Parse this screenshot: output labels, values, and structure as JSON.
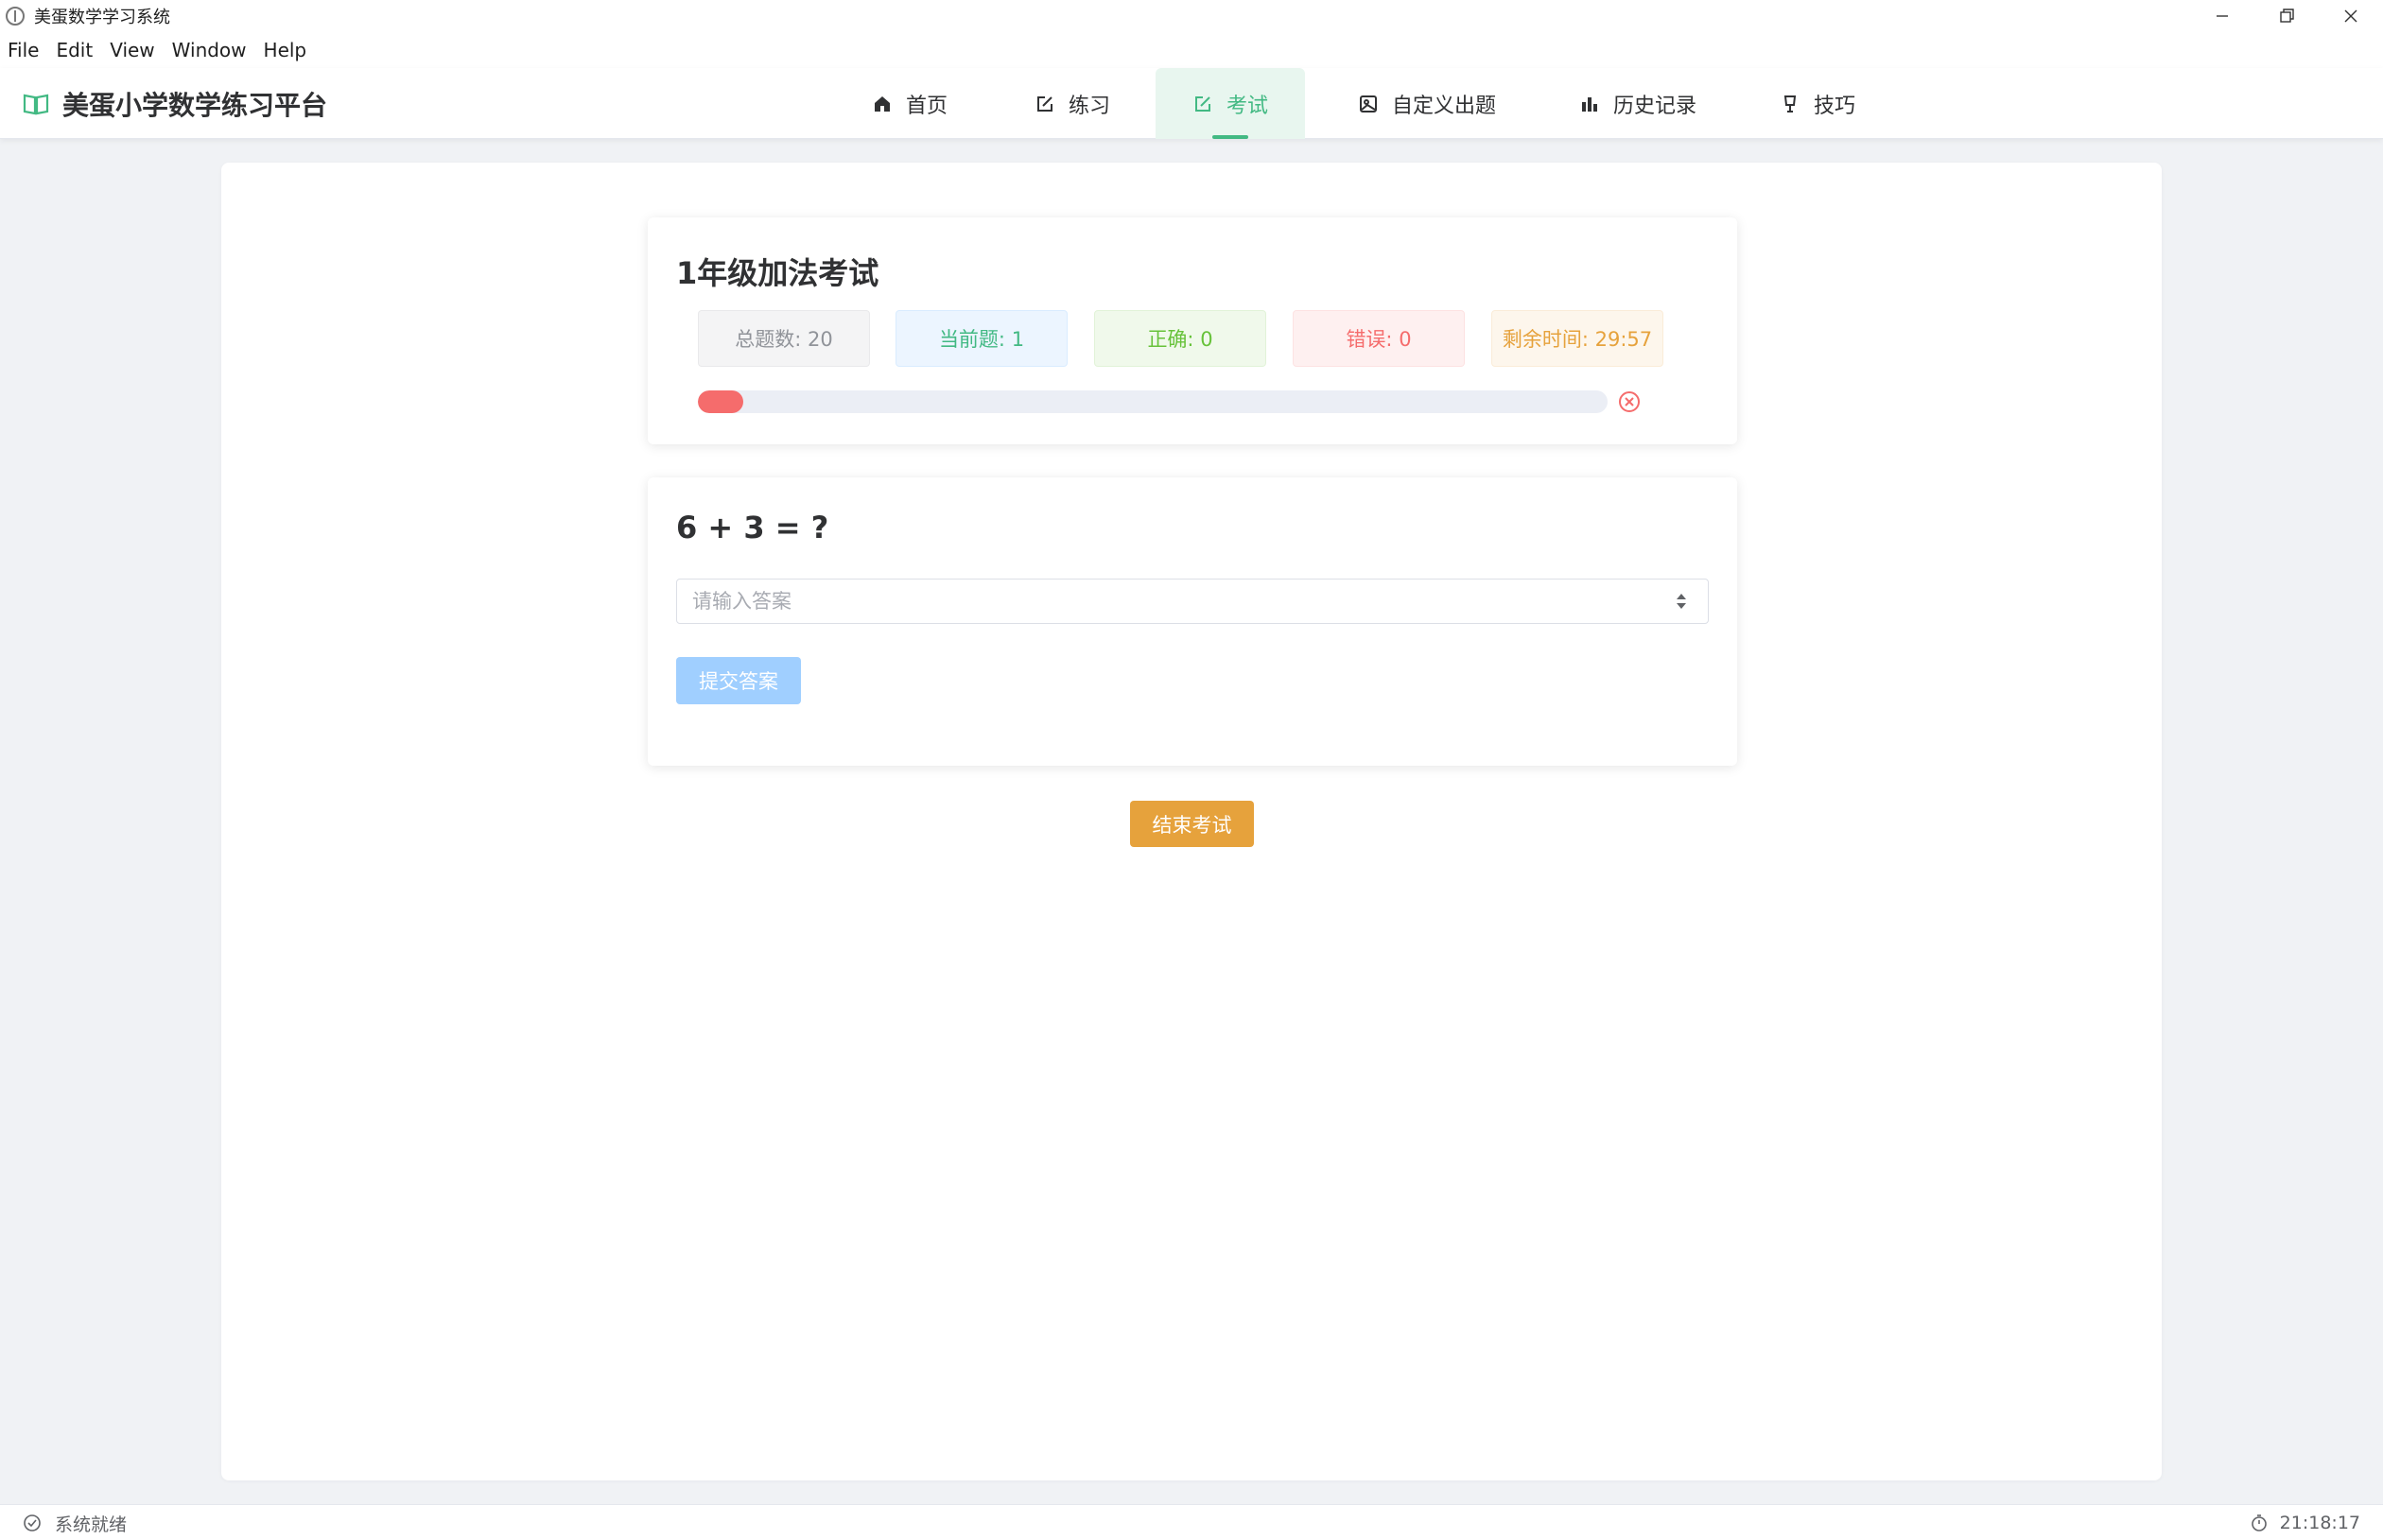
{
  "window": {
    "title": "美蛋数学学习系统"
  },
  "menu": [
    "File",
    "Edit",
    "View",
    "Window",
    "Help"
  ],
  "header": {
    "brand": "美蛋小学数学练习平台",
    "nav": [
      {
        "label": "首页",
        "icon": "home-icon"
      },
      {
        "label": "练习",
        "icon": "edit-icon"
      },
      {
        "label": "考试",
        "icon": "edit-icon",
        "active": true
      },
      {
        "label": "自定义出题",
        "icon": "picture-icon"
      },
      {
        "label": "历史记录",
        "icon": "bar-chart-icon"
      },
      {
        "label": "技巧",
        "icon": "lamp-icon"
      }
    ]
  },
  "exam": {
    "title": "1年级加法考试",
    "stats": {
      "total": "总题数: 20",
      "current": "当前题: 1",
      "correct": "正确: 0",
      "wrong": "错误: 0",
      "time_left": "剩余时间: 29:57"
    },
    "progress_fraction": 0.05,
    "progress_color": "#f56c6c"
  },
  "question": {
    "text": "6 + 3 = ?",
    "answer_value": "",
    "answer_placeholder": "请输入答案",
    "submit_label": "提交答案"
  },
  "end_exam_label": "结束考试",
  "status": {
    "left": "系统就绪",
    "time": "21:18:17"
  },
  "colors": {
    "accent": "#42b983",
    "warning": "#e6a23c",
    "danger": "#f56c6c",
    "disabled_primary": "#a0cfff"
  }
}
